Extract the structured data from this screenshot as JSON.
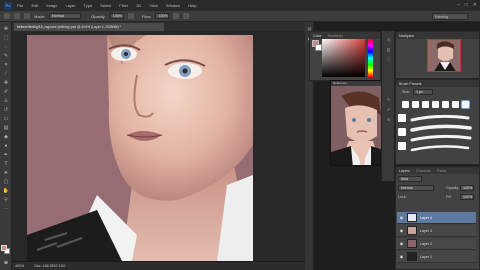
{
  "app": {
    "logo": "Ps"
  },
  "menu": [
    "File",
    "Edit",
    "Image",
    "Layer",
    "Type",
    "Select",
    "Filter",
    "3D",
    "View",
    "Window",
    "Help"
  ],
  "window_controls": [
    "–",
    "□",
    "✕"
  ],
  "options": {
    "mode_label": "Mode:",
    "mode_value": "Normal",
    "opacity_label": "Opacity:",
    "opacity_value": "100%",
    "flow_label": "Flow:",
    "flow_value": "100%",
    "workspace": "Painting"
  },
  "document": {
    "tab_title": "bellanelfeddigi18_ragoose (editing).psd @ 400% (Layer 4, RGB/8#) *",
    "zoom": "400%",
    "doc_info": "Doc: 168.3M/2.10G"
  },
  "color_panel": {
    "tabs": [
      "Color",
      "Swatches"
    ],
    "foreground": "#c98f86",
    "background": "#ffffff"
  },
  "reference_window": {
    "title": "Reference"
  },
  "navigator_panel": {
    "tabs": [
      "Navigator"
    ]
  },
  "brush_panel": {
    "tabs": [
      "Brush Presets"
    ],
    "size_label": "Size:",
    "size_value": "1 px"
  },
  "layers_panel": {
    "tabs": [
      "Layers",
      "Channels",
      "Paths"
    ],
    "filter_label": "Kind",
    "blend_mode": "Normal",
    "opacity_label": "Opacity:",
    "opacity_value": "100%",
    "lock_label": "Lock:",
    "fill_label": "Fill:",
    "fill_value": "100%",
    "layers": [
      {
        "name": "Layer 4",
        "selected": true,
        "thumb": "#e8e8e8"
      },
      {
        "name": "Layer 3",
        "selected": false,
        "thumb": "#c9a69a"
      },
      {
        "name": "Layer 2",
        "selected": false,
        "thumb": "#8a6468"
      },
      {
        "name": "Layer 1",
        "selected": false,
        "thumb": "#222222"
      }
    ]
  }
}
